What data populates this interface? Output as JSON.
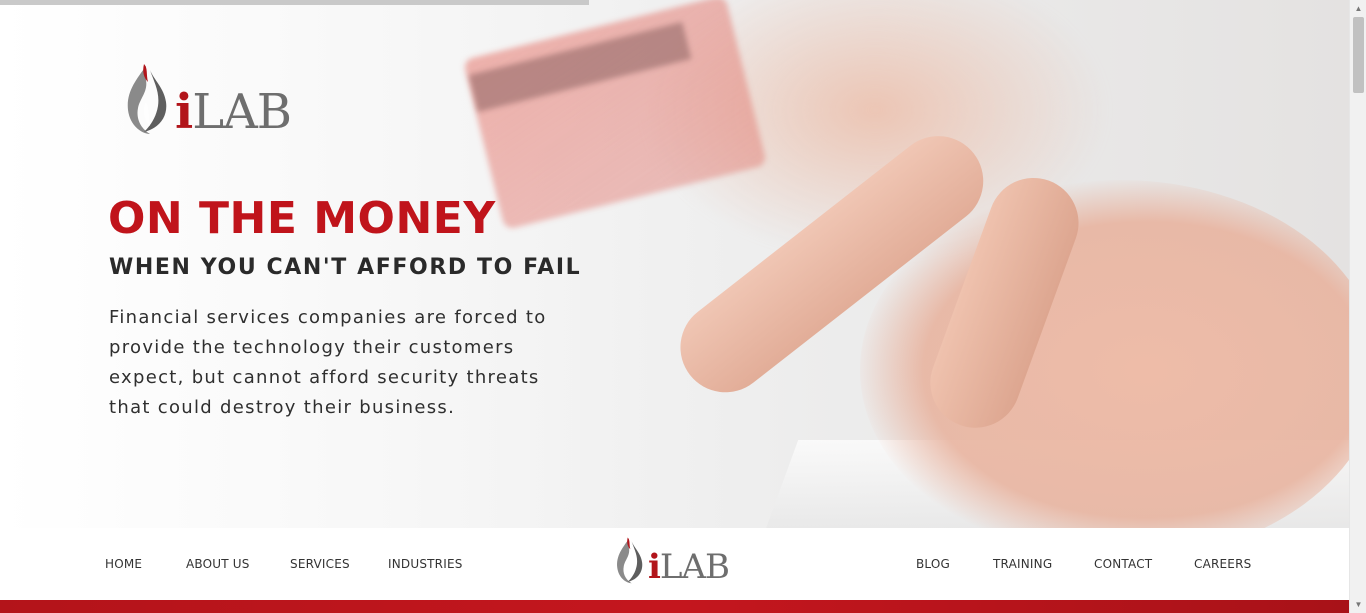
{
  "hero": {
    "headline": "ON THE MONEY",
    "subheadline": "WHEN YOU CAN'T AFFORD TO FAIL",
    "body": "Financial services companies are forced to provide the technology their customers expect, but cannot afford security threats that could destroy their business."
  },
  "brand": {
    "logo_i": "i",
    "logo_rest": "LAB",
    "primary_color": "#c0141b",
    "logo_gray": "#6e6e6e"
  },
  "nav": {
    "left": [
      "HOME",
      "ABOUT US",
      "SERVICES",
      "INDUSTRIES"
    ],
    "right": [
      "BLOG",
      "TRAINING",
      "CONTACT",
      "CAREERS"
    ]
  },
  "icons": {
    "logo_mark": "flame-logo-icon",
    "scroll_up": "chevron-up-icon",
    "scroll_down": "chevron-down-icon"
  }
}
